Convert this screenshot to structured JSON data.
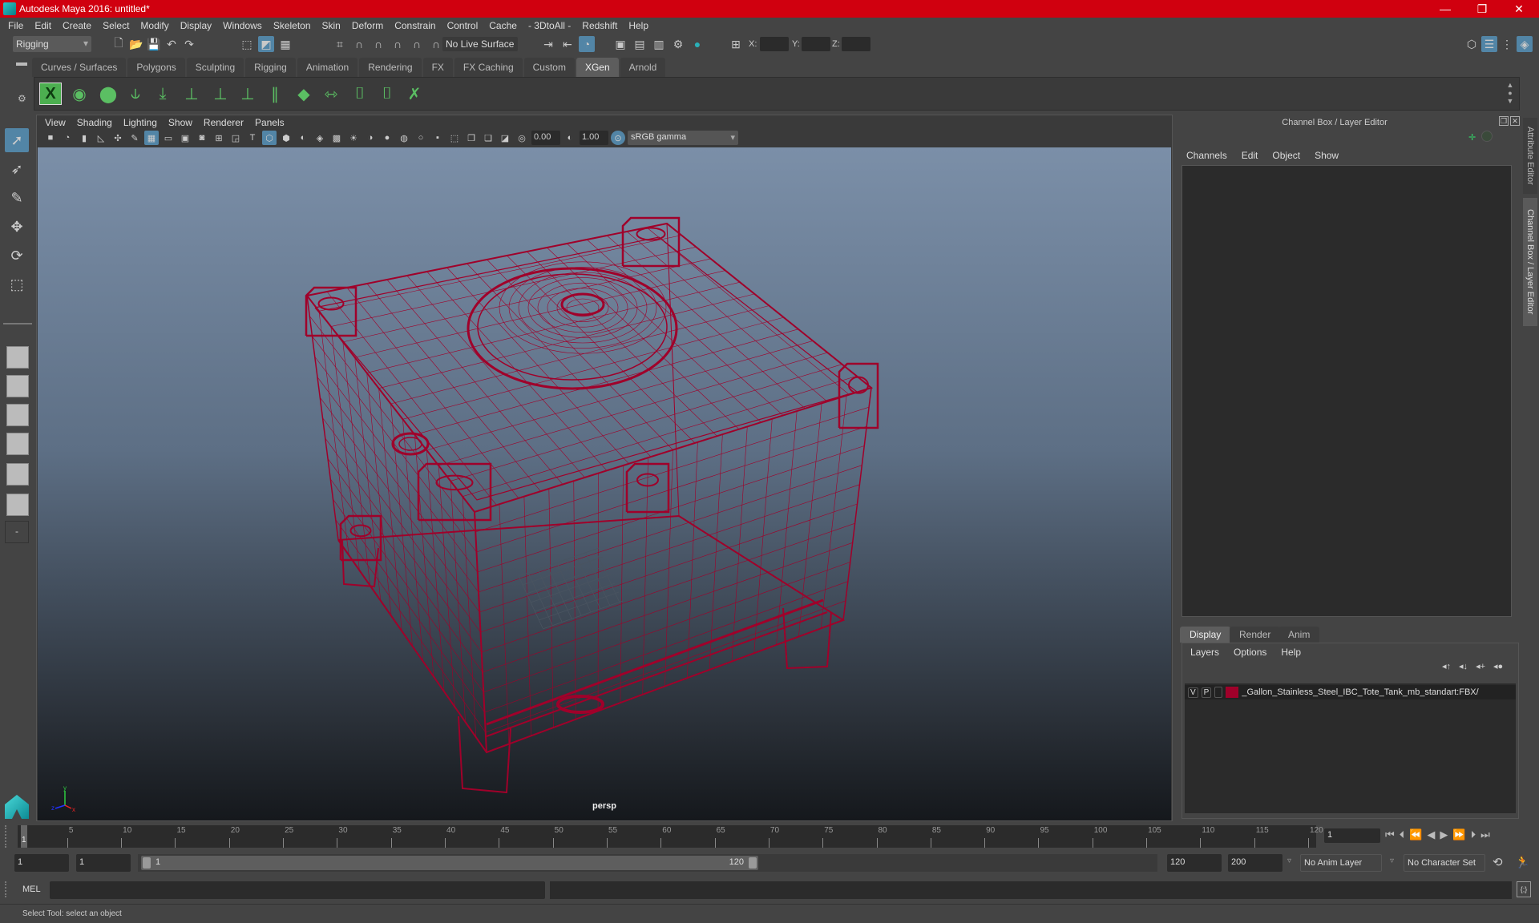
{
  "window": {
    "title": "Autodesk Maya 2016: untitled*",
    "minimize": "—",
    "restore": "❐",
    "close": "✕"
  },
  "menubar": [
    "File",
    "Edit",
    "Create",
    "Select",
    "Modify",
    "Display",
    "Windows",
    "Skeleton",
    "Skin",
    "Deform",
    "Constrain",
    "Control",
    "Cache",
    "- 3DtoAll -",
    "Redshift",
    "Help"
  ],
  "statusline": {
    "menuset": "Rigging",
    "live_surface": "No Live Surface",
    "x_label": "X:",
    "y_label": "Y:",
    "z_label": "Z:"
  },
  "shelf": {
    "tabs": [
      "Curves / Surfaces",
      "Polygons",
      "Sculpting",
      "Rigging",
      "Animation",
      "Rendering",
      "FX",
      "FX Caching",
      "Custom",
      "XGen",
      "Arnold"
    ],
    "active_tab": "XGen",
    "icons": [
      "xgen-editor-icon",
      "create-description-icon",
      "create-collection-icon",
      "add-guides-icon",
      "move-guides-icon",
      "add-guide-icon",
      "sculpt-guides-icon",
      "lock-guides-icon",
      "comb-guides-icon",
      "guide-grid-icon",
      "guide-width-icon",
      "select-guides-icon",
      "guide-bounds-icon",
      "delete-guides-icon"
    ]
  },
  "viewport": {
    "menu": [
      "View",
      "Shading",
      "Lighting",
      "Show",
      "Renderer",
      "Panels"
    ],
    "exposure": "0.00",
    "gamma": "1.00",
    "colorspace": "sRGB gamma",
    "camera": "persp",
    "wire_color": "#a0002a"
  },
  "channelbox": {
    "title": "Channel Box / Layer Editor",
    "menu": [
      "Channels",
      "Edit",
      "Object",
      "Show"
    ]
  },
  "layereditor": {
    "tabs": [
      "Display",
      "Render",
      "Anim"
    ],
    "active_tab": "Display",
    "menu": [
      "Layers",
      "Options",
      "Help"
    ],
    "layers": [
      {
        "v": "V",
        "p": "P",
        "color": "#a0002a",
        "name": "_Gallon_Stainless_Steel_IBC_Tote_Tank_mb_standart:FBX/"
      }
    ]
  },
  "side_tabs": [
    "Attribute Editor",
    "Channel Box / Layer Editor"
  ],
  "timeline": {
    "start": 1,
    "end": 120,
    "current": 1,
    "ticks": [
      5,
      10,
      15,
      20,
      25,
      30,
      35,
      40,
      45,
      50,
      55,
      60,
      65,
      70,
      75,
      80,
      85,
      90,
      95,
      100,
      105,
      110,
      115,
      120
    ],
    "current_field": "1"
  },
  "range": {
    "start_field": "1",
    "anim_start": "1",
    "slider_start": "1",
    "slider_end": "120",
    "anim_end": "120",
    "end_field": "200",
    "anim_layer": "No Anim Layer",
    "character_set": "No Character Set"
  },
  "cmdline": {
    "lang": "MEL"
  },
  "helpline": "Select Tool: select an object"
}
